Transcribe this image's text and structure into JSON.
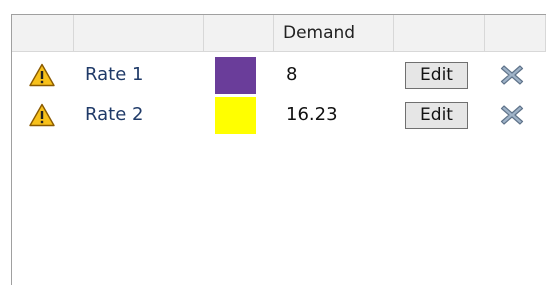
{
  "columns": [
    "",
    "",
    "",
    "Demand",
    "",
    ""
  ],
  "rows": [
    {
      "status_icon": "warning-icon",
      "name": "Rate 1",
      "color": "#6a3d9a",
      "demand": "8",
      "edit_label": "Edit",
      "delete_icon": "delete-x-icon"
    },
    {
      "status_icon": "warning-icon",
      "name": "Rate 2",
      "color": "#ffff00",
      "demand": "16.23",
      "edit_label": "Edit",
      "delete_icon": "delete-x-icon"
    }
  ]
}
